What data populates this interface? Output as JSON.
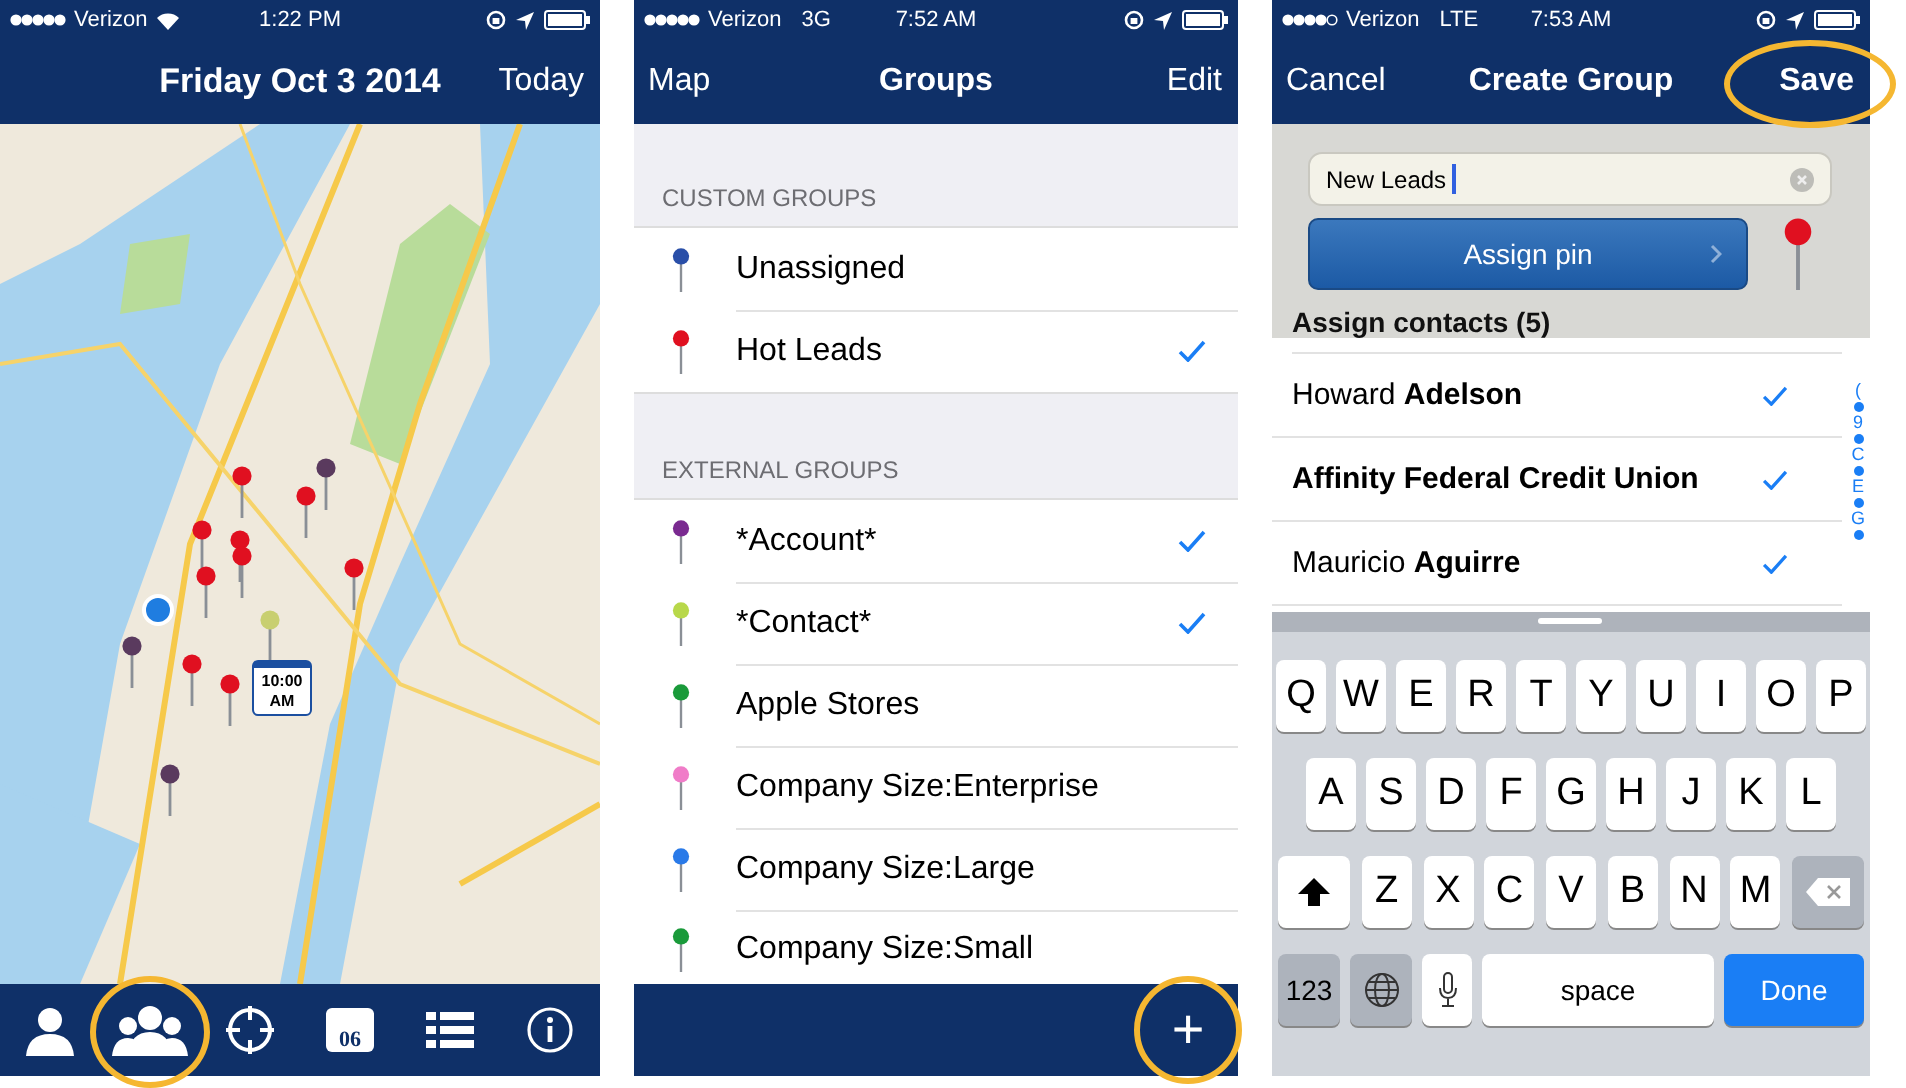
{
  "screens": [
    {
      "kind": "map",
      "status": {
        "carrier": "Verizon",
        "time": "1:22 PM",
        "signal_full": true
      },
      "nav": {
        "title": "Friday Oct 3 2014",
        "right": "Today"
      },
      "map": {
        "kind": "picture",
        "callout": "10:00 AM",
        "pins": [
          {
            "color": "#e01020"
          },
          {
            "color": "#e01020"
          },
          {
            "color": "#5a3a5e"
          },
          {
            "color": "#e01020"
          },
          {
            "color": "#e01020"
          },
          {
            "color": "#e01020"
          },
          {
            "color": "#e01020"
          },
          {
            "color": "#e01020"
          },
          {
            "color": "#c8cf70"
          },
          {
            "color": "#5a3a5e"
          },
          {
            "color": "#e01020"
          },
          {
            "color": "#e01020"
          },
          {
            "color": "#5a3a5e"
          }
        ]
      },
      "tabbar": [
        {
          "kind": "person",
          "highlighted": false
        },
        {
          "kind": "group",
          "highlighted": true
        },
        {
          "kind": "crosshair",
          "highlighted": false
        },
        {
          "kind": "calendar",
          "text": "06",
          "highlighted": false
        },
        {
          "kind": "list",
          "highlighted": false
        },
        {
          "kind": "info",
          "highlighted": false
        }
      ]
    },
    {
      "kind": "groups",
      "status": {
        "carrier": "Verizon",
        "network": "3G",
        "time": "7:52 AM",
        "signal_full": true
      },
      "nav": {
        "left": "Map",
        "title": "Groups",
        "right": "Edit"
      },
      "sections": [
        {
          "header": "CUSTOM GROUPS",
          "items": [
            {
              "label": "Unassigned",
              "color": "#2a4fa8",
              "checked": false
            },
            {
              "label": "Hot Leads",
              "color": "#e01020",
              "checked": true
            }
          ]
        },
        {
          "header": "EXTERNAL GROUPS",
          "items": [
            {
              "label": "*Account*",
              "color": "#7a2a90",
              "checked": true
            },
            {
              "label": "*Contact*",
              "color": "#b8d84a",
              "checked": true
            },
            {
              "label": "Apple Stores",
              "color": "#1a9a3a",
              "checked": false
            },
            {
              "label": "Company Size:Enterprise",
              "color": "#f07cc8",
              "checked": false
            },
            {
              "label": "Company Size:Large",
              "color": "#2a7ae8",
              "checked": false
            },
            {
              "label": "Company Size:Small",
              "color": "#1a9a3a",
              "checked": false
            }
          ]
        }
      ],
      "bottom": {
        "add": "+",
        "highlighted": true
      }
    },
    {
      "kind": "create",
      "status": {
        "carrier": "Verizon",
        "network": "LTE",
        "time": "7:53 AM",
        "signal_full": false
      },
      "nav": {
        "left": "Cancel",
        "title": "Create Group",
        "right": "Save",
        "right_highlighted": true
      },
      "name_value": "New Leads",
      "assign_pin": "Assign pin",
      "pin": {
        "color": "#e01020"
      },
      "contacts_header": "Assign contacts (5)",
      "contacts": [
        {
          "kind": "person",
          "name": "Howard **Adelson**",
          "checked": true
        },
        {
          "kind": "company",
          "name": "Affinity Federal Credit Union",
          "checked": true
        },
        {
          "kind": "person",
          "name": "Mauricio **Aguirre**",
          "checked": true
        }
      ],
      "index": [
        "(",
        "9",
        "C",
        "E",
        "G"
      ],
      "keyboard": [
        [
          {
            "kind": "letter",
            "label": "Q"
          },
          {
            "kind": "letter",
            "label": "W"
          },
          {
            "kind": "letter",
            "label": "E"
          },
          {
            "kind": "letter",
            "label": "R"
          },
          {
            "kind": "letter",
            "label": "T"
          },
          {
            "kind": "letter",
            "label": "Y"
          },
          {
            "kind": "letter",
            "label": "U"
          },
          {
            "kind": "letter",
            "label": "I"
          },
          {
            "kind": "letter",
            "label": "O"
          },
          {
            "kind": "letter",
            "label": "P"
          }
        ],
        [
          {
            "kind": "letter",
            "label": "A"
          },
          {
            "kind": "letter",
            "label": "S"
          },
          {
            "kind": "letter",
            "label": "D"
          },
          {
            "kind": "letter",
            "label": "F"
          },
          {
            "kind": "letter",
            "label": "G"
          },
          {
            "kind": "letter",
            "label": "H"
          },
          {
            "kind": "letter",
            "label": "J"
          },
          {
            "kind": "letter",
            "label": "K"
          },
          {
            "kind": "letter",
            "label": "L"
          }
        ],
        [
          {
            "kind": "shift"
          },
          {
            "kind": "letter",
            "label": "Z"
          },
          {
            "kind": "letter",
            "label": "X"
          },
          {
            "kind": "letter",
            "label": "C"
          },
          {
            "kind": "letter",
            "label": "V"
          },
          {
            "kind": "letter",
            "label": "B"
          },
          {
            "kind": "letter",
            "label": "N"
          },
          {
            "kind": "letter",
            "label": "M"
          },
          {
            "kind": "delete"
          }
        ],
        [
          {
            "kind": "mode",
            "label": "123"
          },
          {
            "kind": "globe"
          },
          {
            "kind": "mic"
          },
          {
            "kind": "space",
            "label": "space"
          },
          {
            "kind": "done",
            "label": "Done"
          }
        ]
      ]
    }
  ]
}
